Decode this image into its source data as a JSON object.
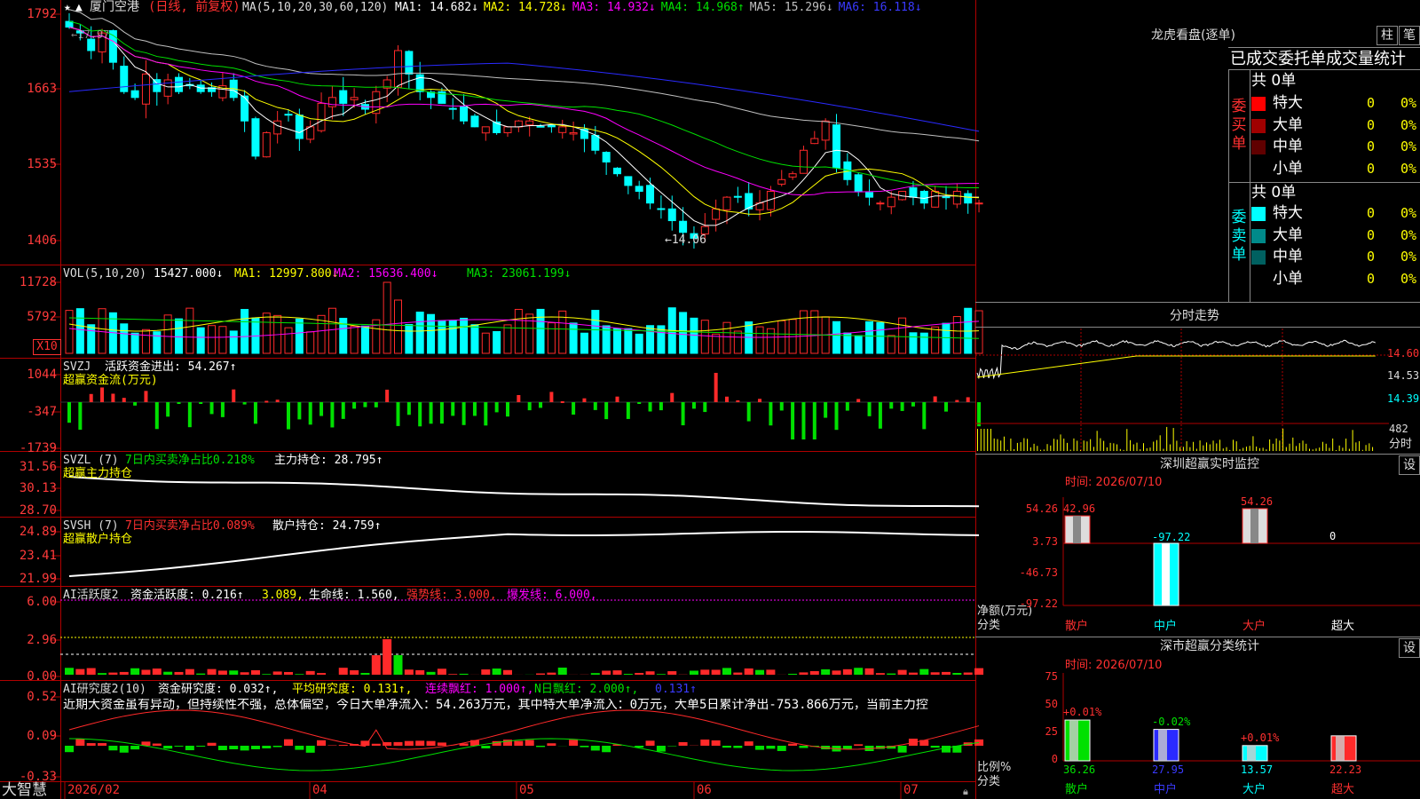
{
  "colors": {
    "up": "#ff2a2a",
    "down": "#00ffff",
    "green": "#00e000",
    "yellow": "#ffff00",
    "magenta": "#ff00ff",
    "white": "#ffffff",
    "gray": "#c0c0c0",
    "blue": "#2a2aff",
    "grid": "#b00000"
  },
  "main": {
    "stock": "厦门空港",
    "mode": "(日线, 前复权)",
    "ma_params": "MA(5,10,20,30,60,120)",
    "ma": [
      {
        "label": "MA1:",
        "value": "14.682↓",
        "color": "#ffffff"
      },
      {
        "label": "MA2:",
        "value": "14.728↓",
        "color": "#ffff00"
      },
      {
        "label": "MA3:",
        "value": "14.932↓",
        "color": "#ff00ff"
      },
      {
        "label": "MA4:",
        "value": "14.968↑",
        "color": "#00e000"
      },
      {
        "label": "MA5:",
        "value": "15.296↓",
        "color": "#c0c0c0"
      },
      {
        "label": "MA6:",
        "value": "16.118↓",
        "color": "#3a3aff"
      }
    ],
    "yticks": [
      "1792",
      "1663",
      "1535",
      "1406"
    ],
    "high_label": "←17.97",
    "low_label": "←14.06"
  },
  "vol": {
    "params": "VOL(5,10,20)",
    "value": "15427.000↓",
    "ma1": "MA1: 12997.800↓",
    "ma2": "MA2: 15636.400↓",
    "ma3": "MA3: 23061.199↓",
    "yticks": [
      "11728",
      "5792"
    ],
    "unit": "X10"
  },
  "svzj": {
    "name": "SVZJ",
    "label": "活跃资金进出: 54.267↑",
    "sub": "超赢资金流(万元)",
    "yticks": [
      "1044",
      "-347",
      "-1739"
    ]
  },
  "svzl": {
    "name": "SVZL (7)",
    "desc": "7日内买卖净占比0.218%",
    "label": "主力持仓: 28.795↑",
    "sub": "超赢主力持仓",
    "yticks": [
      "31.56",
      "30.13",
      "28.70"
    ]
  },
  "svsh": {
    "name": "SVSH (7)",
    "desc": "7日内买卖净占比0.089%",
    "label": "散户持仓: 24.759↑",
    "sub": "超赢散户持仓",
    "yticks": [
      "24.89",
      "23.41",
      "21.99"
    ]
  },
  "ai1": {
    "name": "AI活跃度2",
    "l1": "资金活跃度: 0.216↑",
    "l2": "3.089,",
    "l3": "生命线: 1.560,",
    "l4": "强势线: 3.000,",
    "l5": "爆发线: 6.000,",
    "yticks": [
      "6.00",
      "2.96",
      "0.00"
    ]
  },
  "ai2": {
    "name": "AI研究度2(10)",
    "l1": "资金研究度: 0.032↑,",
    "l2": "平均研究度: 0.131↑,",
    "l3": "连续飘红: 1.000↑,",
    "l4": "N日飘红: 2.000↑,",
    "l5": "0.131↑",
    "comment": "近期大资金虽有异动，但持续性不强，总体偏空，今日大单净流入：54.263万元，其中特大单净流入：0万元，大单5日累计净出-753.866万元，当前主力控",
    "yticks": [
      "0.52",
      "0.09",
      "-0.33"
    ]
  },
  "xaxis": {
    "brand": "大智慧",
    "labels": [
      "2026/02",
      "04",
      "05",
      "06",
      "07"
    ]
  },
  "right": {
    "lhb_title": "龙虎看盘(逐单)",
    "btn1": "柱",
    "btn2": "笔",
    "tabs": "已成交委托单成交量统计",
    "buy_side": "委买单",
    "sell_side": "委卖单",
    "buy_total": "共 0单",
    "sell_total": "共 0单",
    "buy_rows": [
      {
        "name": "特大",
        "v": "0",
        "p": "0%",
        "color": "#ff0000"
      },
      {
        "name": "大单",
        "v": "0",
        "p": "0%",
        "color": "#a00000"
      },
      {
        "name": "中单",
        "v": "0",
        "p": "0%",
        "color": "#600000"
      },
      {
        "name": "小单",
        "v": "0",
        "p": "0%",
        "color": ""
      }
    ],
    "sell_rows": [
      {
        "name": "特大",
        "v": "0",
        "p": "0%",
        "color": "#00ffff"
      },
      {
        "name": "大单",
        "v": "0",
        "p": "0%",
        "color": "#008a8a"
      },
      {
        "name": "中单",
        "v": "0",
        "p": "0%",
        "color": "#006060"
      },
      {
        "name": "小单",
        "v": "0",
        "p": "0%",
        "color": ""
      }
    ],
    "fenshi_title": "分时走势",
    "fenshi_y": [
      "14.60",
      "14.53",
      "14.39"
    ],
    "fenshi_vol": "482",
    "fenshi_unit": "分时",
    "mon_title": "深圳超赢实时监控",
    "mon_btn": "设",
    "mon_time": "时间: 2026/07/10",
    "mon_y": [
      "54.26",
      "3.73",
      "-46.73",
      "-97.22"
    ],
    "mon_vals": [
      "42.96",
      "-97.22",
      "54.26",
      "0"
    ],
    "mon_unit1": "净额(万元)",
    "mon_unit2": "分类",
    "mon_cats": [
      "散户",
      "中户",
      "大户",
      "超大"
    ],
    "cls_title": "深市超赢分类统计",
    "cls_btn": "设",
    "cls_time": "时间: 2026/07/10",
    "cls_y": [
      "75",
      "50",
      "25",
      "0"
    ],
    "cls_top": [
      "+0.01%",
      "-0.02%",
      "+0.01%"
    ],
    "cls_vals": [
      "36.26",
      "27.95",
      "13.57",
      "22.23"
    ],
    "cls_unit1": "比例%",
    "cls_unit2": "分类",
    "cls_cats": [
      "散户",
      "中户",
      "大户",
      "超大"
    ]
  }
}
